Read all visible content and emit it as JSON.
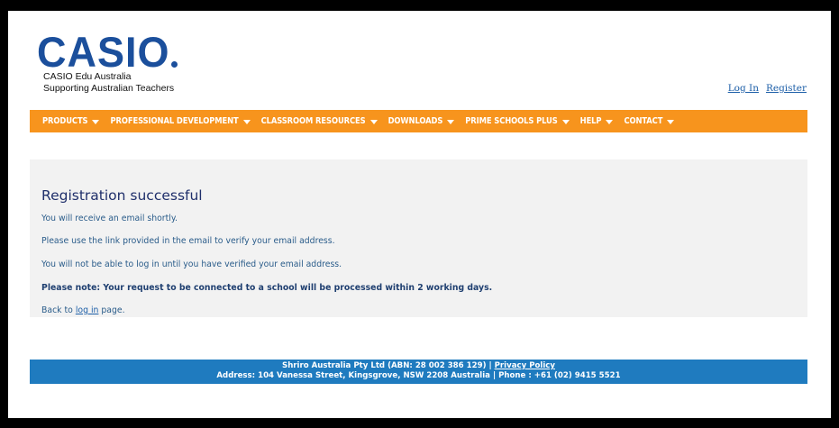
{
  "header": {
    "logo": "CASIO",
    "tagline_line1": "CASIO Edu Australia",
    "tagline_line2": "Supporting Australian Teachers",
    "login_link": "Log In",
    "register_link": "Register"
  },
  "nav": {
    "items": [
      {
        "label": "PRODUCTS"
      },
      {
        "label": "PROFESSIONAL DEVELOPMENT"
      },
      {
        "label": "CLASSROOM RESOURCES"
      },
      {
        "label": "DOWNLOADS"
      },
      {
        "label": "PRIME SCHOOLS PLUS"
      },
      {
        "label": "HELP"
      },
      {
        "label": "CONTACT"
      }
    ]
  },
  "main": {
    "title": "Registration successful",
    "line1": "You will receive an email shortly.",
    "line2": "Please use the link provided in the email to verify your email address.",
    "line3": "You will not be able to log in until you have verified your email address.",
    "note": "Please note: Your request to be connected to a school will be processed within 2 working days.",
    "back_prefix": "Back to ",
    "back_link": "log in",
    "back_suffix": " page."
  },
  "footer": {
    "company": "Shriro Australia Pty Ltd (ABN: 28 002 386 129) | ",
    "privacy_link": "Privacy Policy",
    "address": "Address: 104 Vanessa Street, Kingsgrove, NSW 2208 Australia | Phone : +61 (02) 9415 5521"
  },
  "colors": {
    "brand_blue": "#1b4f9c",
    "nav_orange": "#f7941d",
    "footer_blue": "#1f7bbf"
  }
}
